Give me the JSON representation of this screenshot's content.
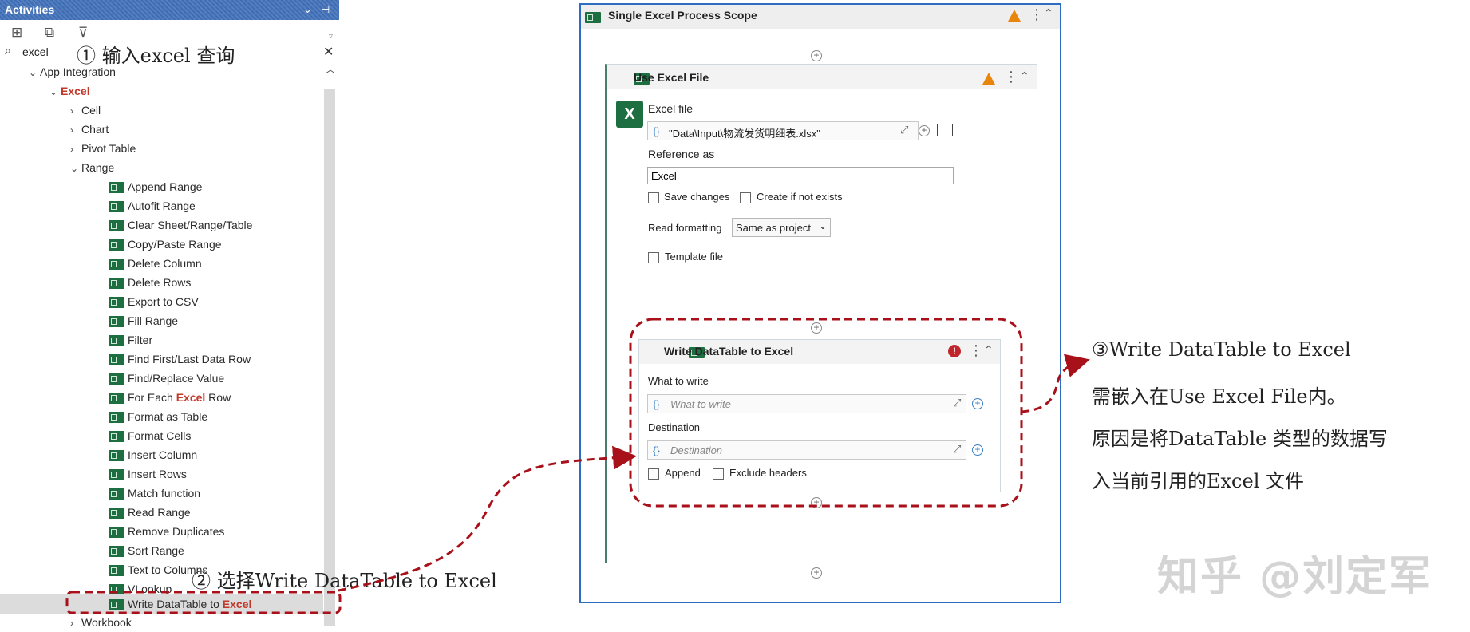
{
  "activities_panel": {
    "title": "Activities",
    "search_value": "excel",
    "tree": {
      "app_integration": "App Integration",
      "excel": "Excel",
      "cell": "Cell",
      "chart": "Chart",
      "pivot_table": "Pivot Table",
      "range": "Range",
      "items": [
        "Append Range",
        "Autofit Range",
        "Clear Sheet/Range/Table",
        "Copy/Paste Range",
        "Delete Column",
        "Delete Rows",
        "Export to CSV",
        "Fill Range",
        "Filter",
        "Find First/Last Data Row",
        "Find/Replace Value"
      ],
      "for_each_pre": "For Each ",
      "for_each_excel": "Excel",
      "for_each_post": " Row",
      "items2": [
        "Format as Table",
        "Format Cells",
        "Insert Column",
        "Insert Rows",
        "Match function",
        "Read Range",
        "Remove Duplicates",
        "Sort Range",
        "Text to Columns",
        "VLookup"
      ],
      "write_pre": "Write DataTable to ",
      "write_excel": "Excel",
      "workbook": "Workbook"
    }
  },
  "designer": {
    "scope_title": "Single Excel Process Scope",
    "use_excel": {
      "title": "Use Excel File",
      "excel_file_label": "Excel file",
      "excel_file_value": "\"Data\\Input\\物流发货明细表.xlsx\"",
      "reference_label": "Reference as",
      "reference_value": "Excel",
      "save_changes": "Save changes",
      "create_if_not_exists": "Create if not exists",
      "read_formatting_label": "Read formatting",
      "read_formatting_value": "Same as project",
      "template_file": "Template file"
    },
    "write_dt": {
      "title": "Write DataTable to Excel",
      "what_label": "What to write",
      "what_placeholder": "What to write",
      "dest_label": "Destination",
      "dest_placeholder": "Destination",
      "append": "Append",
      "exclude_headers": "Exclude headers"
    }
  },
  "annotations": {
    "step1": "① 输入excel 查询",
    "step2": "② 选择Write DataTable to Excel",
    "step3_line1": "③Write DataTable to Excel",
    "step3_line2": "需嵌入在Use Excel File内。",
    "step3_line3": "原因是将DataTable 类型的数据写",
    "step3_line4": "入当前引用的Excel 文件",
    "watermark": "知乎 @刘定军"
  },
  "colors": {
    "annotation_red": "#c0161e",
    "header_blue": "#3e6db5",
    "excel_green": "#1d6f42",
    "warning": "#e8850c",
    "error": "#c0272d"
  }
}
